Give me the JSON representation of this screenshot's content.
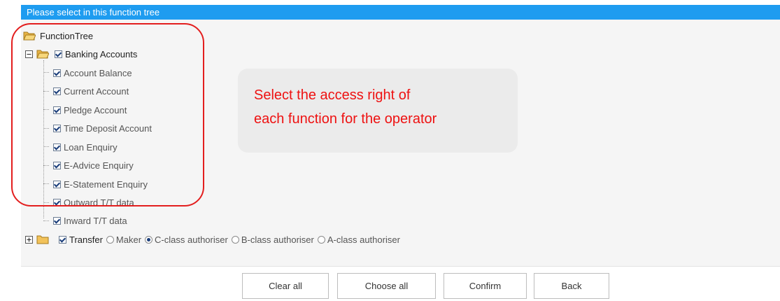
{
  "header": {
    "title": "Please select in this function tree"
  },
  "tree": {
    "root_label": "FunctionTree",
    "banking": {
      "label": "Banking Accounts",
      "items": [
        "Account Balance",
        "Current Account",
        "Pledge Account",
        "Time Deposit Account",
        "Loan Enquiry",
        "E-Advice Enquiry",
        "E-Statement Enquiry",
        "Outward T/T data",
        "Inward T/T data"
      ]
    },
    "transfer": {
      "label": "Transfer",
      "options": [
        "Maker",
        "C-class authoriser",
        "B-class authoriser",
        "A-class authoriser"
      ],
      "selected": "C-class authoriser"
    }
  },
  "annotation": {
    "line1": "Select the access right of",
    "line2": "each function for the operator"
  },
  "buttons": {
    "clear_all": "Clear all",
    "choose_all": "Choose all",
    "confirm": "Confirm",
    "back": "Back"
  },
  "colors": {
    "header": "#1e9cf0",
    "annotation_text": "#ee1111",
    "outline": "#e31e1e",
    "folder": "#f2c25a"
  }
}
